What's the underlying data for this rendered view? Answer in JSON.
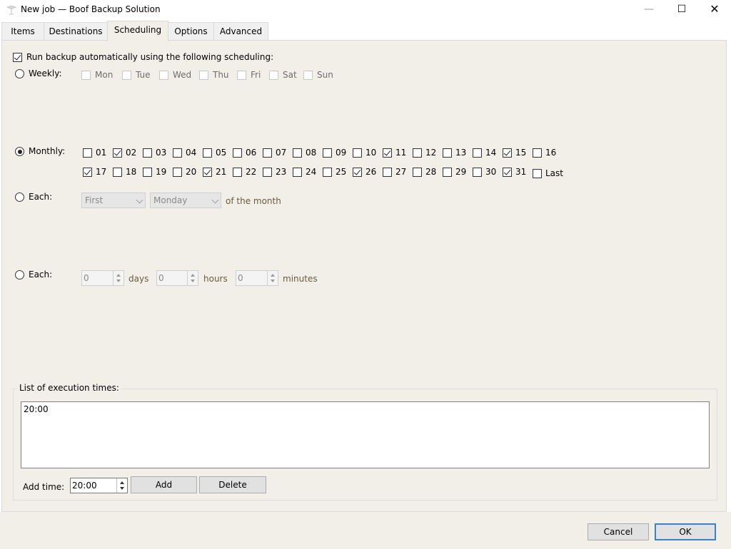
{
  "window": {
    "title": "New job — Boof Backup Solution",
    "minimize_icon": "—",
    "maximize_icon": "☐",
    "close_icon": "✕"
  },
  "tabs": [
    {
      "label": "Items"
    },
    {
      "label": "Destinations"
    },
    {
      "label": "Scheduling",
      "active": true
    },
    {
      "label": "Options"
    },
    {
      "label": "Advanced"
    }
  ],
  "scheduling": {
    "auto_label": "Run backup automatically using the following scheduling:",
    "auto_checked": true,
    "weekly": {
      "label": "Weekly:",
      "days": [
        {
          "label": "Mon",
          "checked": false
        },
        {
          "label": "Tue",
          "checked": false
        },
        {
          "label": "Wed",
          "checked": false
        },
        {
          "label": "Thu",
          "checked": false
        },
        {
          "label": "Fri",
          "checked": false
        },
        {
          "label": "Sat",
          "checked": false
        },
        {
          "label": "Sun",
          "checked": false
        }
      ]
    },
    "monthly": {
      "label": "Monthly:",
      "selected": true,
      "days": [
        {
          "label": "01",
          "checked": false
        },
        {
          "label": "02",
          "checked": true
        },
        {
          "label": "03",
          "checked": false
        },
        {
          "label": "04",
          "checked": false
        },
        {
          "label": "05",
          "checked": false
        },
        {
          "label": "06",
          "checked": false
        },
        {
          "label": "07",
          "checked": false
        },
        {
          "label": "08",
          "checked": false
        },
        {
          "label": "09",
          "checked": false
        },
        {
          "label": "10",
          "checked": false
        },
        {
          "label": "11",
          "checked": true
        },
        {
          "label": "12",
          "checked": false
        },
        {
          "label": "13",
          "checked": false
        },
        {
          "label": "14",
          "checked": false
        },
        {
          "label": "15",
          "checked": true
        },
        {
          "label": "16",
          "checked": false
        },
        {
          "label": "17",
          "checked": true
        },
        {
          "label": "18",
          "checked": false
        },
        {
          "label": "19",
          "checked": false
        },
        {
          "label": "20",
          "checked": false
        },
        {
          "label": "21",
          "checked": true
        },
        {
          "label": "22",
          "checked": false
        },
        {
          "label": "23",
          "checked": false
        },
        {
          "label": "24",
          "checked": false
        },
        {
          "label": "25",
          "checked": false
        },
        {
          "label": "26",
          "checked": true
        },
        {
          "label": "27",
          "checked": false
        },
        {
          "label": "28",
          "checked": false
        },
        {
          "label": "29",
          "checked": false
        },
        {
          "label": "30",
          "checked": false
        },
        {
          "label": "31",
          "checked": true
        },
        {
          "label": "Last",
          "checked": false
        }
      ]
    },
    "each_month": {
      "label": "Each:",
      "ordinal_value": "First",
      "weekday_value": "Monday",
      "suffix": "of the month"
    },
    "each_interval": {
      "label": "Each:",
      "days_value": "0",
      "days_label": "days",
      "hours_value": "0",
      "hours_label": "hours",
      "minutes_value": "0",
      "minutes_label": "minutes"
    },
    "exec_times": {
      "group_title": "List of execution times:",
      "items": [
        "20:00"
      ],
      "add_time_label": "Add time:",
      "add_time_value": "20:00",
      "add_button": "Add",
      "delete_button": "Delete"
    }
  },
  "footer": {
    "cancel_button": "Cancel",
    "ok_button": "OK"
  }
}
